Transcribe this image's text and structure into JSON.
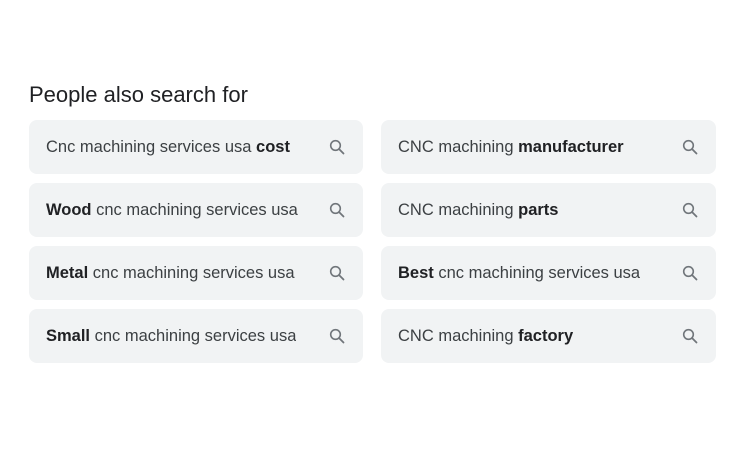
{
  "section": {
    "title": "People also search for"
  },
  "suggestions": [
    {
      "pre": "Cnc machining services usa ",
      "bold": "cost",
      "post": "",
      "icon": "search-icon"
    },
    {
      "pre": "CNC machining ",
      "bold": "manufacturer",
      "post": "",
      "icon": "search-icon"
    },
    {
      "pre": "",
      "bold": "Wood",
      "post": " cnc machining services usa",
      "icon": "search-icon"
    },
    {
      "pre": "CNC machining ",
      "bold": "parts",
      "post": "",
      "icon": "search-icon"
    },
    {
      "pre": "",
      "bold": "Metal",
      "post": " cnc machining services usa",
      "icon": "search-icon"
    },
    {
      "pre": "",
      "bold": "Best",
      "post": " cnc machining services usa",
      "icon": "search-icon"
    },
    {
      "pre": "",
      "bold": "Small",
      "post": " cnc machining services usa",
      "icon": "search-icon"
    },
    {
      "pre": "CNC machining ",
      "bold": "factory",
      "post": "",
      "icon": "search-icon"
    }
  ],
  "colors": {
    "chip_background": "#f1f3f4",
    "text": "#3c4043",
    "icon": "#70757a"
  }
}
